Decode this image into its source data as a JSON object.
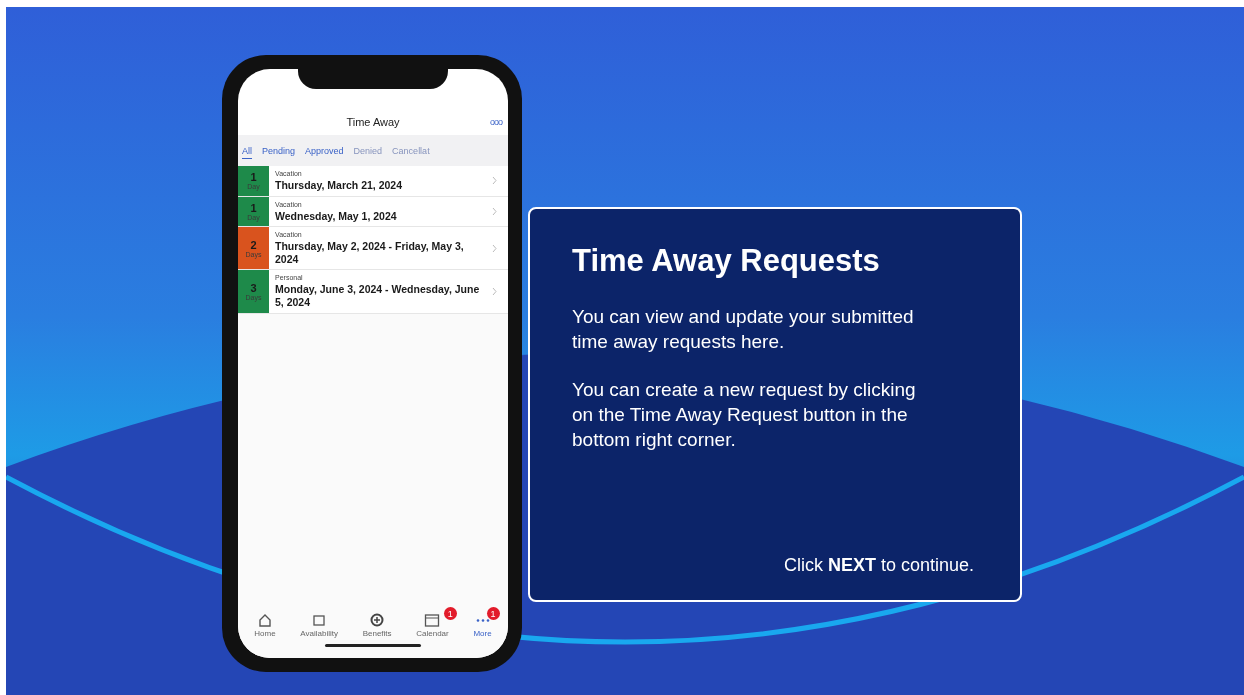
{
  "phone": {
    "title": "Time Away",
    "menu_icon": "ooo",
    "tabs": [
      {
        "label": "All",
        "selected": true,
        "disabled": false
      },
      {
        "label": "Pending",
        "selected": false,
        "disabled": false
      },
      {
        "label": "Approved",
        "selected": false,
        "disabled": false
      },
      {
        "label": "Denied",
        "selected": false,
        "disabled": true
      },
      {
        "label": "Cancellat",
        "selected": false,
        "disabled": true
      }
    ],
    "requests": [
      {
        "count": "1",
        "unit": "Day",
        "color": "#1e8a4a",
        "type": "Vacation",
        "dates": "Thursday, March 21, 2024"
      },
      {
        "count": "1",
        "unit": "Day",
        "color": "#1e8a4a",
        "type": "Vacation",
        "dates": "Wednesday, May 1, 2024"
      },
      {
        "count": "2",
        "unit": "Days",
        "color": "#d9531e",
        "type": "Vacation",
        "dates": "Thursday, May 2, 2024 - Friday, May 3, 2024"
      },
      {
        "count": "3",
        "unit": "Days",
        "color": "#1e8a4a",
        "type": "Personal",
        "dates": "Monday, June 3, 2024 - Wednesday, June 5, 2024"
      }
    ],
    "nav": [
      {
        "kind": "home",
        "label": "Home",
        "selected": false
      },
      {
        "kind": "availability",
        "label": "Availability",
        "selected": false
      },
      {
        "kind": "benefits",
        "label": "Benefits",
        "selected": false
      },
      {
        "kind": "calendar",
        "label": "Calendar",
        "selected": false,
        "badge": "1"
      },
      {
        "kind": "more",
        "label": "More",
        "selected": true,
        "badge": "1"
      }
    ]
  },
  "card": {
    "title": "Time Away Requests",
    "paragraphs": [
      "You can view and update your submitted time away requests here.",
      "You can create a new request by clicking on the Time Away Request button in the bottom right corner."
    ],
    "footer": "Click **NEXT** to continue."
  }
}
